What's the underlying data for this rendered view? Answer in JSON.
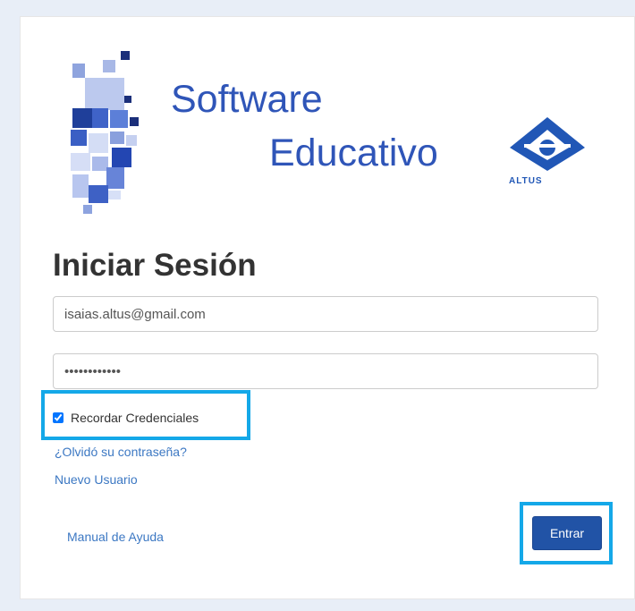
{
  "brand": {
    "line1": "Software",
    "line2": "Educativo",
    "company": "ALTUS"
  },
  "login": {
    "heading": "Iniciar Sesión",
    "email_value": "isaias.altus@gmail.com",
    "password_value": "••••••••••••",
    "remember_label": "Recordar Credenciales",
    "remember_checked": true,
    "forgot_link": "¿Olvidó su contraseña?",
    "new_user_link": "Nuevo Usuario",
    "manual_link": "Manual de Ayuda",
    "submit_label": "Entrar"
  },
  "colors": {
    "brand_blue": "#2f55b8",
    "button_blue": "#2153a6",
    "link_blue": "#3c78c3",
    "highlight": "#14a8e8"
  }
}
